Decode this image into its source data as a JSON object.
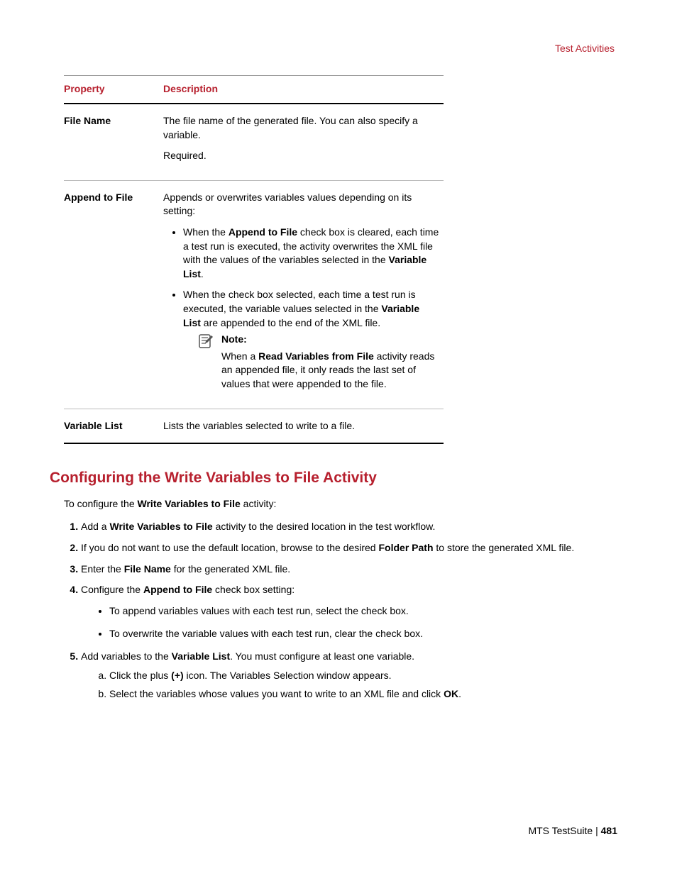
{
  "header": {
    "section": "Test Activities"
  },
  "table": {
    "col1": "Property",
    "col2": "Description",
    "rows": {
      "r1": {
        "prop": "File Name",
        "p1": "The file name of the generated file. You can also specify a variable.",
        "p2": "Required."
      },
      "r2": {
        "prop": "Append to File",
        "intro": "Appends or overwrites variables values depending on its setting:",
        "b1a": "When the ",
        "b1b": "Append to File",
        "b1c": " check box is cleared, each time a test run is executed, the activity overwrites the XML file with the values of the variables selected in the ",
        "b1d": "Variable List",
        "b1e": ".",
        "b2a": "When the check box selected, each time a test run is executed, the variable values selected in the ",
        "b2b": "Variable List",
        "b2c": " are appended to the end of the XML file.",
        "note_title": "Note:",
        "note_a": "When a ",
        "note_b": "Read Variables from File",
        "note_c": " activity reads an appended file, it only reads the last set of values that were appended to the file."
      },
      "r3": {
        "prop": "Variable List",
        "desc": "Lists the variables selected to write to a file."
      }
    }
  },
  "section": {
    "heading": "Configuring the Write Variables to File Activity",
    "intro_a": "To configure the ",
    "intro_b": "Write Variables to File",
    "intro_c": " activity:",
    "s1a": "Add a ",
    "s1b": "Write Variables to File",
    "s1c": " activity to the desired location in the test workflow.",
    "s2a": "If you do not want to use the default location, browse to the desired ",
    "s2b": "Folder Path",
    "s2c": " to store the generated XML file.",
    "s3a": "Enter the ",
    "s3b": "File Name",
    "s3c": " for the generated XML file.",
    "s4a": "Configure the ",
    "s4b": "Append to File",
    "s4c": " check box setting:",
    "s4_sub1": "To append variables values with each test run, select the check box.",
    "s4_sub2": "To overwrite the variable values with each test run, clear the check box.",
    "s5a": "Add variables to the ",
    "s5b": "Variable List",
    "s5c": ". You must configure at least one variable.",
    "s5_aa": "Click the plus ",
    "s5_ab": "(+)",
    "s5_ac": " icon. The Variables Selection window appears.",
    "s5_ba": "Select the variables whose values you want to write to an XML file and click ",
    "s5_bb": "OK",
    "s5_bc": "."
  },
  "footer": {
    "product": "MTS TestSuite",
    "sep": " | ",
    "page": "481"
  }
}
